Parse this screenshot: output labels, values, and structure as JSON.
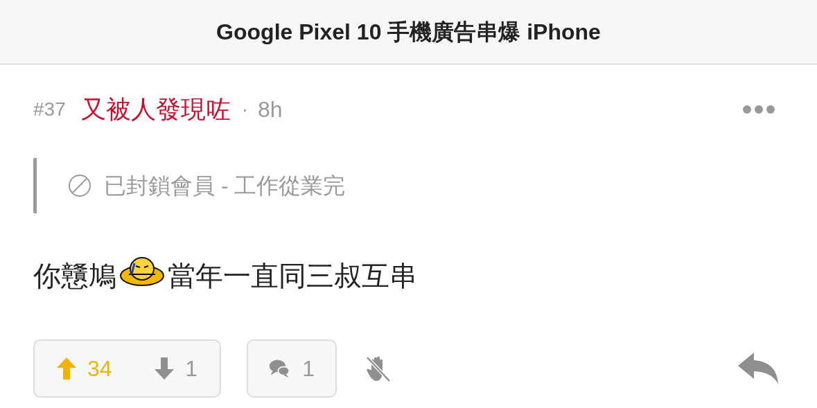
{
  "header": {
    "title": "Google Pixel 10 手機廣告串爆 iPhone"
  },
  "post": {
    "floor": "#37",
    "author": "又被人發現咗",
    "separator": "·",
    "time": "8h",
    "quote": {
      "text": "已封鎖會員 - 工作從業完"
    },
    "content": {
      "before": "你戇鳩",
      "after": "當年一直同三叔互串"
    },
    "upvotes": "34",
    "downvotes": "1",
    "comments": "1"
  }
}
